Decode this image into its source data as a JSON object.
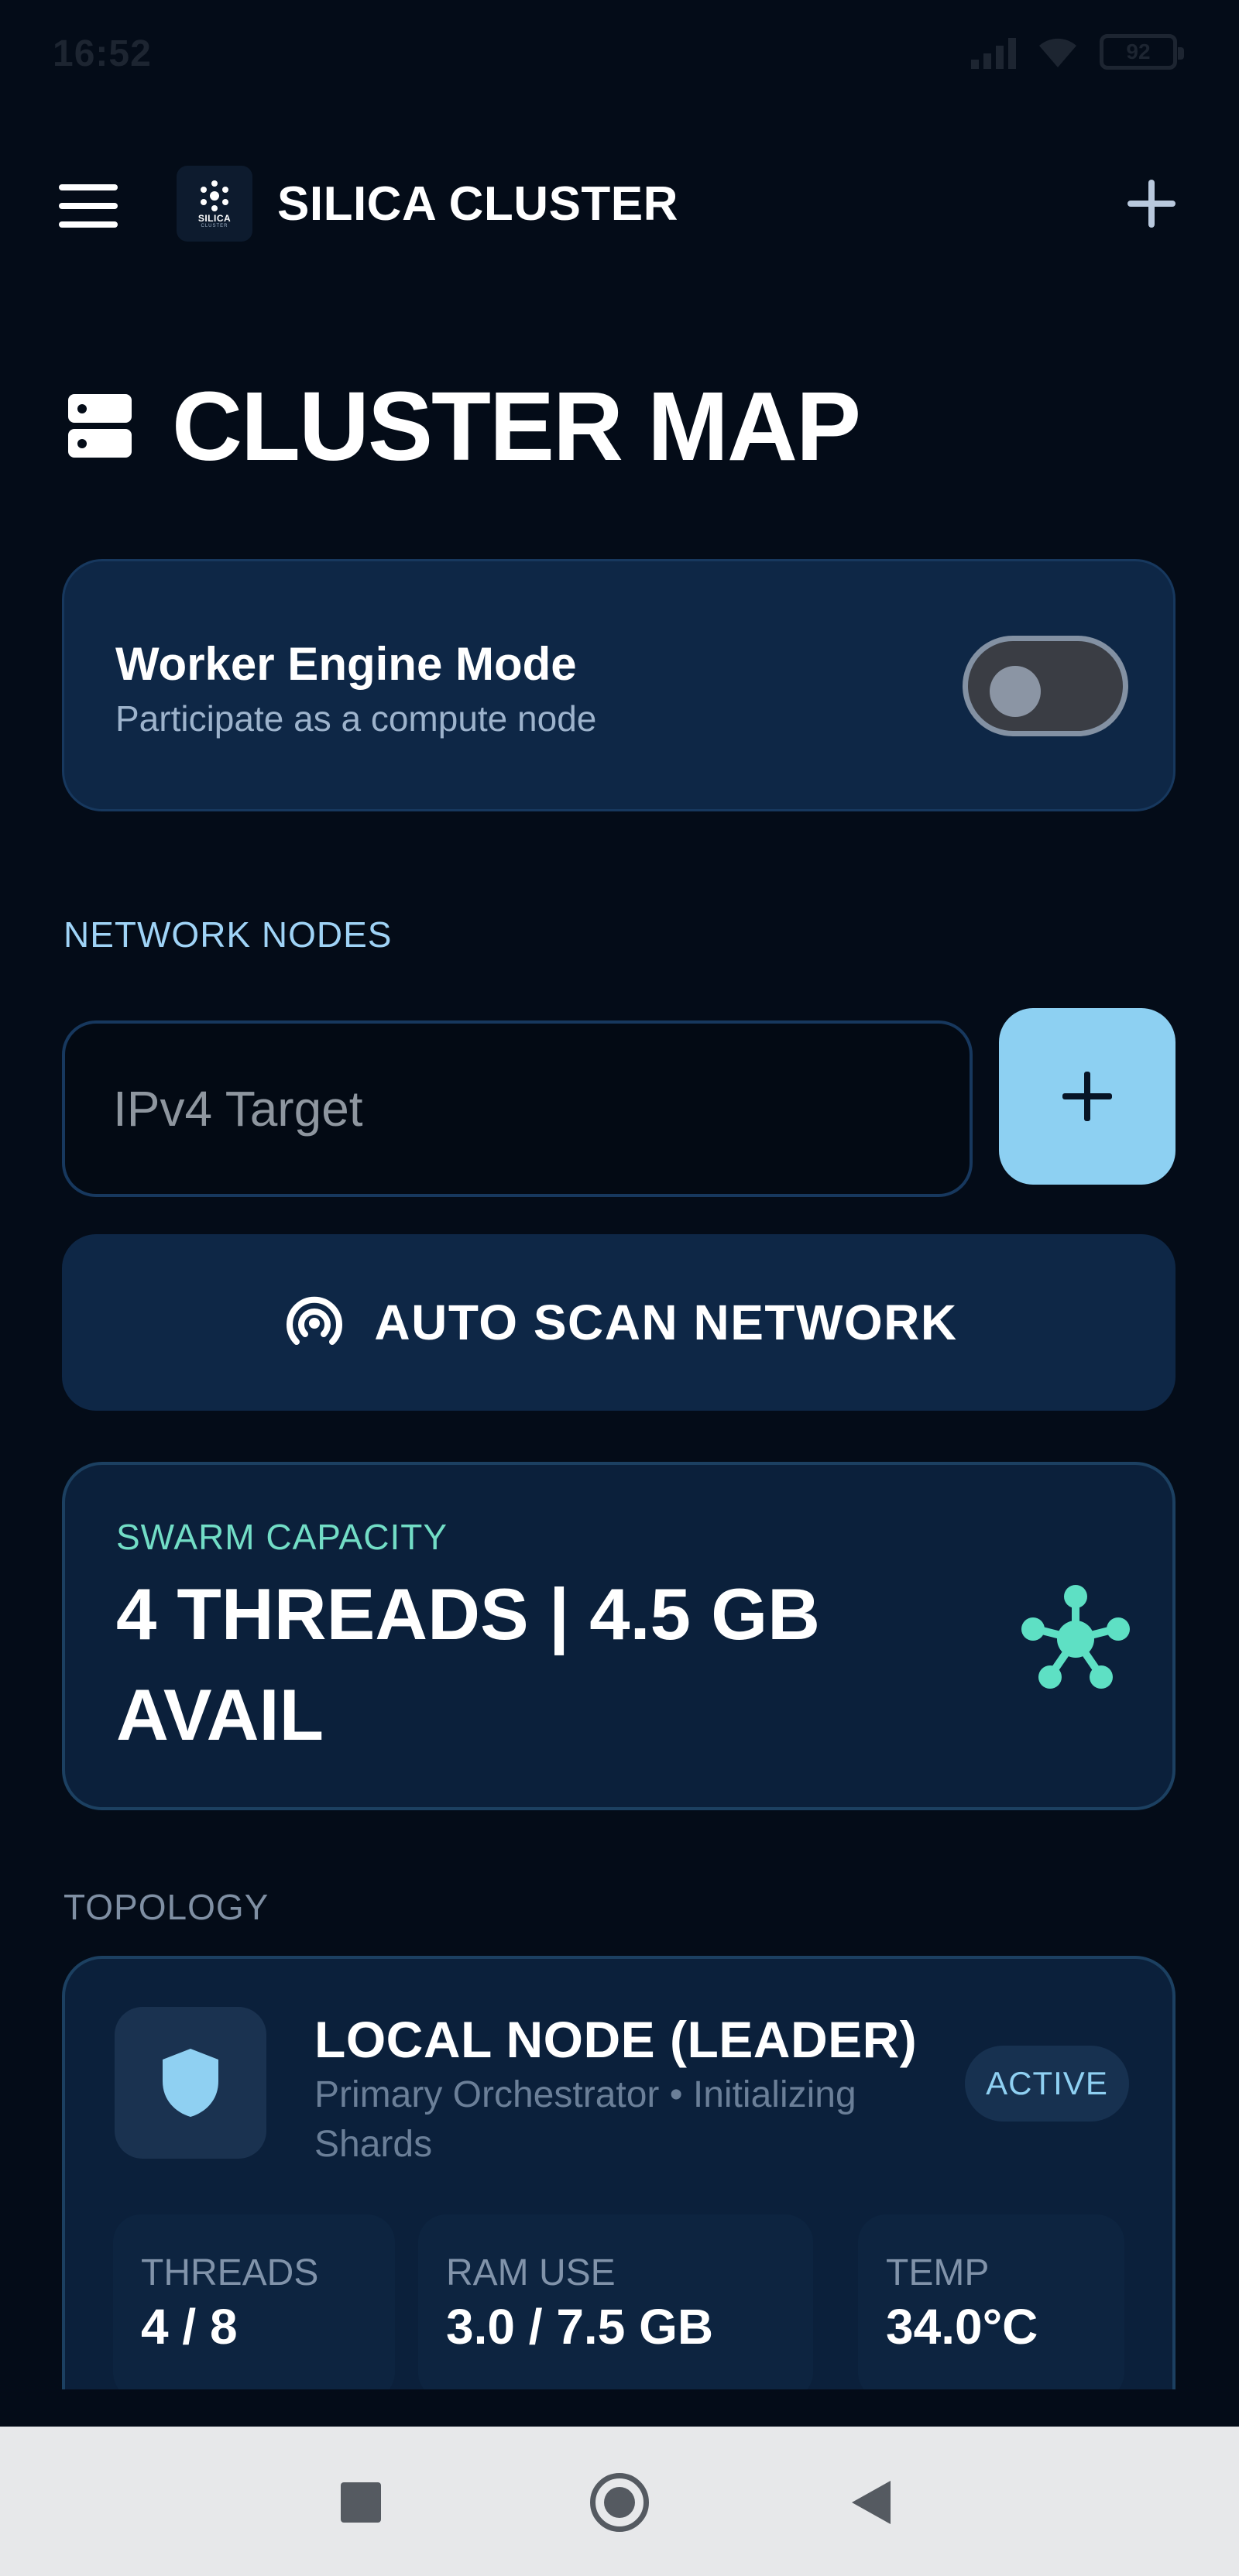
{
  "status_bar": {
    "time": "16:52",
    "battery": "92"
  },
  "header": {
    "logo_text": "SILICA",
    "logo_sub": "CLUSTER",
    "title": "SILICA CLUSTER"
  },
  "page": {
    "title": "CLUSTER MAP"
  },
  "worker_mode": {
    "title": "Worker Engine Mode",
    "subtitle": "Participate as a compute node",
    "enabled": false
  },
  "network_nodes": {
    "section_label": "NETWORK NODES",
    "ip_placeholder": "IPv4 Target",
    "ip_value": "",
    "scan_label": "AUTO SCAN NETWORK"
  },
  "swarm": {
    "label": "SWARM CAPACITY",
    "value": "4 THREADS | 4.5 GB AVAIL"
  },
  "topology": {
    "section_label": "TOPOLOGY",
    "nodes": [
      {
        "title": "LOCAL NODE (LEADER)",
        "subtitle": "Primary Orchestrator • Initializing Shards",
        "status": "ACTIVE",
        "stats": [
          {
            "label": "THREADS",
            "value": "4 / 8"
          },
          {
            "label": "RAM USE",
            "value": "3.0 / 7.5 GB"
          },
          {
            "label": "TEMP",
            "value": "34.0°C"
          }
        ]
      }
    ]
  },
  "colors": {
    "background": "#040c18",
    "card": "#0e2746",
    "accent_blue": "#8dd0f2",
    "accent_teal": "#5ee0c4",
    "muted_text": "#9db3cc"
  },
  "icons": {
    "menu": "hamburger-menu-icon",
    "add": "plus-icon",
    "page": "server-stack-icon",
    "scan": "wifi-radar-icon",
    "swarm": "network-hub-icon",
    "node": "shield-icon"
  }
}
